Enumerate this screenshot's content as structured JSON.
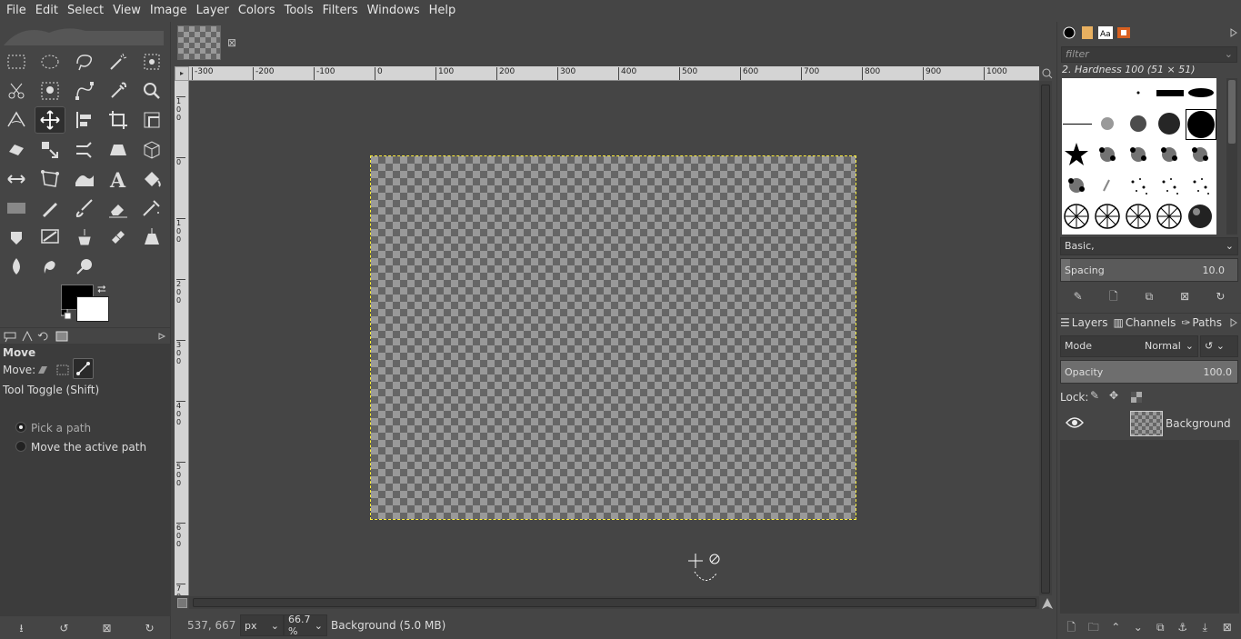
{
  "menubar": {
    "items": [
      "File",
      "Edit",
      "Select",
      "View",
      "Image",
      "Layer",
      "Colors",
      "Tools",
      "Filters",
      "Windows",
      "Help"
    ]
  },
  "toolbox": {
    "active_tool": "Move",
    "colors": {
      "foreground": "#000000",
      "background": "#ffffff"
    },
    "options": {
      "title": "Move",
      "move_label": "Move:",
      "tool_toggle": "Tool Toggle  (Shift)",
      "radio_pick": "Pick a path",
      "radio_move": "Move the active path"
    }
  },
  "image_window": {
    "ruler_top_labels": [
      "-300",
      "-200",
      "-100",
      "0",
      "100",
      "200",
      "300",
      "400",
      "500",
      "600",
      "700",
      "800",
      "900",
      "1000"
    ],
    "ruler_left_labels": [
      "-100",
      "0",
      "100",
      "200",
      "300",
      "400",
      "500",
      "600",
      "700"
    ],
    "status": {
      "coords": "537, 667",
      "unit": "px",
      "zoom": "66.7 %",
      "layer_info": "Background (5.0 MB)"
    }
  },
  "brushes": {
    "filter_placeholder": "filter",
    "selected_title": "2. Hardness 100 (51 × 51)",
    "tag_combo": "Basic,",
    "spacing_label": "Spacing",
    "spacing_value": "10.0",
    "spacing_fraction": 0.05
  },
  "layers": {
    "tabs": [
      "Layers",
      "Channels",
      "Paths"
    ],
    "mode_label": "Mode",
    "mode_value": "Normal",
    "opacity_label": "Opacity",
    "opacity_value": "100.0",
    "opacity_fraction": 1.0,
    "lock_label": "Lock:",
    "items": [
      {
        "name": "Background",
        "visible": true
      }
    ]
  }
}
